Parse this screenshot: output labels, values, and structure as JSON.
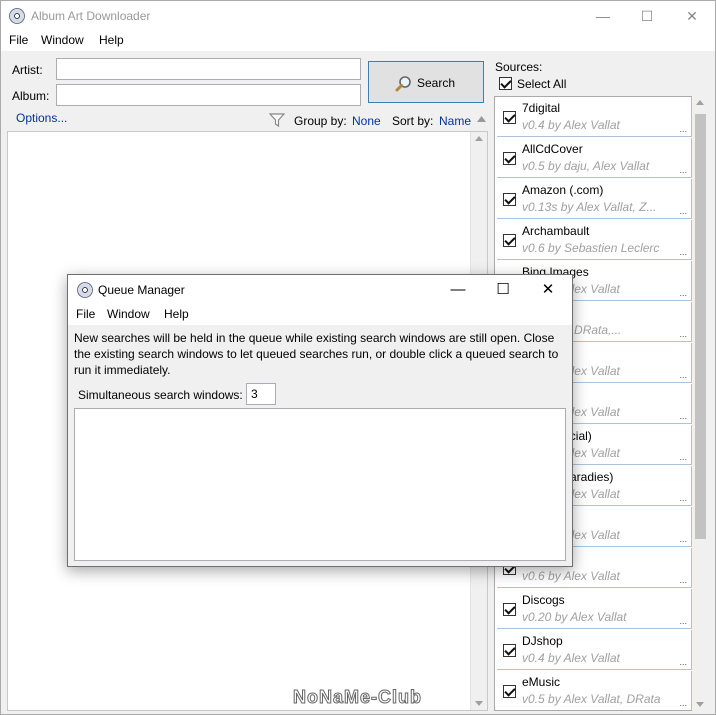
{
  "app": {
    "title": "Album Art Downloader",
    "minimize": "—",
    "maximize": "☐",
    "close": "✕"
  },
  "menu": [
    "File",
    "Window",
    "Help"
  ],
  "search": {
    "artist_label": "Artist:",
    "album_label": "Album:",
    "artist_value": "",
    "album_value": "",
    "button_label": "Search",
    "options_label": "Options...",
    "group_by_label": "Group by:",
    "group_by_value": "None",
    "sort_by_label": "Sort by:",
    "sort_by_value": "Name"
  },
  "sources": {
    "header": "Sources:",
    "select_all": "Select All",
    "items": [
      {
        "name": "7digital",
        "version": "v0.4 by Alex Vallat"
      },
      {
        "name": "AllCdCover",
        "version": "v0.5 by daju, Alex Vallat"
      },
      {
        "name": "Amazon (.com)",
        "version": "v0.13s by Alex Vallat, Z..."
      },
      {
        "name": "Archambault",
        "version": "v0.6 by Sebastien Leclerc"
      },
      {
        "name": "Bing Images",
        "version": "v0.5 by Alex Vallat"
      },
      {
        "name": "",
        "version": "...elsaan, DRata,..."
      },
      {
        "name": "",
        "version": "v0.4 by Alex Vallat"
      },
      {
        "name": "",
        "version": "v0.5 by Alex Vallat"
      },
      {
        "name": "...lia (Official)",
        "version": "v0.4 by Alex Vallat"
      },
      {
        "name": "(Cover-Paradies)",
        "version": "v0.4 by Alex Vallat"
      },
      {
        "name": "",
        "version": "v0.3 by Alex Vallat"
      },
      {
        "name": "",
        "version": "v0.6 by Alex Vallat"
      },
      {
        "name": "Discogs",
        "version": "v0.20 by Alex Vallat"
      },
      {
        "name": "DJshop",
        "version": "v0.4 by Alex Vallat"
      },
      {
        "name": "eMusic",
        "version": "v0.5 by Alex Vallat, DRata"
      }
    ]
  },
  "queue_manager": {
    "title": "Queue Manager",
    "minimize": "—",
    "maximize": "☐",
    "close": "✕",
    "menu": [
      "File",
      "Window",
      "Help"
    ],
    "message": "New searches will be held in the queue while existing search windows are still open. Close the existing search windows to let queued searches run, or double click a queued search to run it immediately.",
    "simultaneous_label": "Simultaneous search windows:",
    "simultaneous_value": "3"
  },
  "watermark": "NoNaMe-Club"
}
